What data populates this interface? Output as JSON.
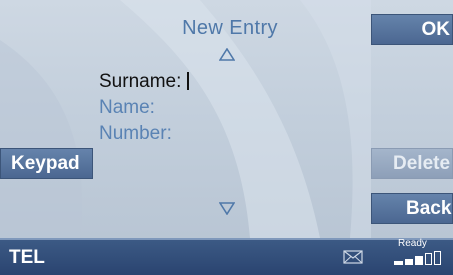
{
  "title": "New Entry",
  "fields": [
    {
      "label": "Surname:",
      "active": true
    },
    {
      "label": "Name:",
      "active": false
    },
    {
      "label": "Number:",
      "active": false
    }
  ],
  "buttons": {
    "ok": "OK",
    "keypad": "Keypad",
    "delete": "Delete",
    "back": "Back"
  },
  "status": {
    "mode": "TEL",
    "state": "Ready",
    "signal_bars_filled": 3,
    "signal_bars_total": 5
  },
  "icons": {
    "scroll_up": "triangle-up-outline",
    "scroll_down": "triangle-down-outline",
    "message": "envelope",
    "signal": "signal-strength-bars"
  },
  "colors": {
    "accent_text": "#5a83b4",
    "button": "#5775a0",
    "button_disabled": "#9aaec6",
    "status_bar": "#30497a"
  }
}
